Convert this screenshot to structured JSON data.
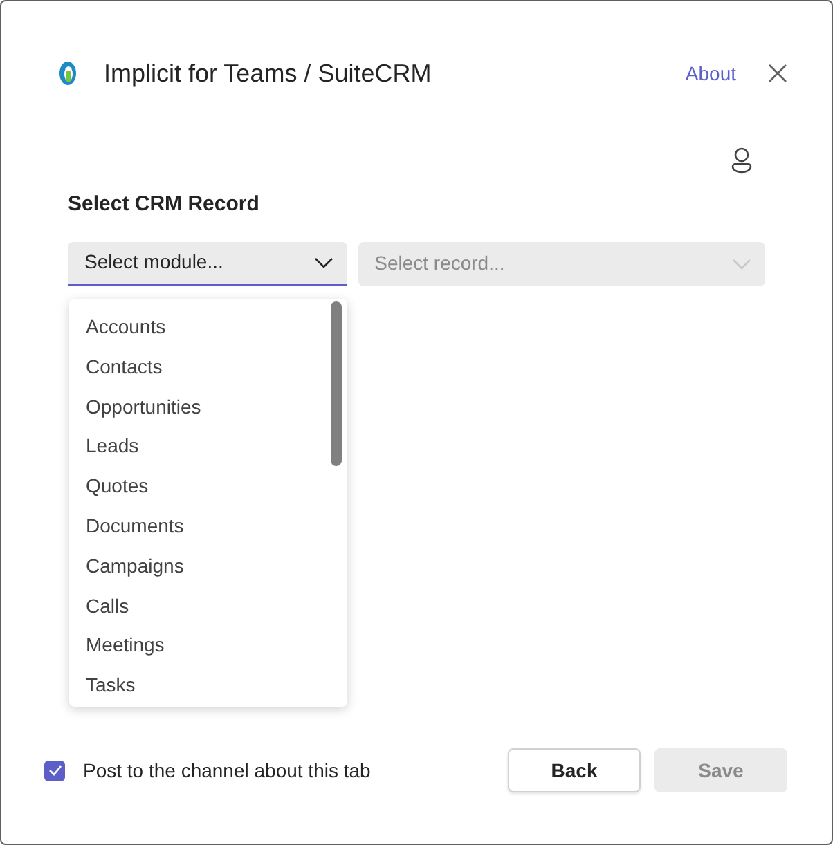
{
  "header": {
    "title": "Implicit for Teams / SuiteCRM",
    "about_link": "About"
  },
  "section_title": "Select CRM Record",
  "module_select": {
    "placeholder": "Select module...",
    "expanded": true
  },
  "record_select": {
    "placeholder": "Select record...",
    "disabled": true
  },
  "module_options": [
    {
      "label": "Accounts"
    },
    {
      "label": "Contacts"
    },
    {
      "label": "Opportunities"
    },
    {
      "label": "Leads"
    },
    {
      "label": "Quotes"
    },
    {
      "label": "Documents"
    },
    {
      "label": "Campaigns"
    },
    {
      "label": "Calls"
    },
    {
      "label": "Meetings"
    },
    {
      "label": "Tasks"
    }
  ],
  "post_to_channel": {
    "label": "Post to the channel about this tab",
    "checked": true
  },
  "buttons": [
    {
      "label": "Back",
      "disabled": false
    },
    {
      "label": "Save",
      "disabled": true
    }
  ]
}
